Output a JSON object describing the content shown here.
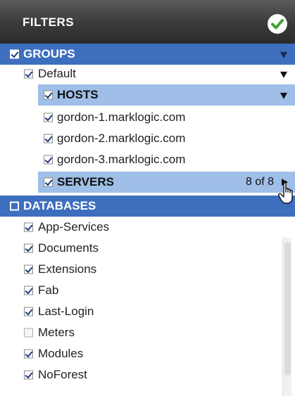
{
  "header": {
    "title": "FILTERS"
  },
  "groups": {
    "label": "GROUPS"
  },
  "default_group": {
    "label": "Default"
  },
  "hosts": {
    "label": "HOSTS",
    "items": [
      "gordon-1.marklogic.com",
      "gordon-2.marklogic.com",
      "gordon-3.marklogic.com"
    ]
  },
  "servers": {
    "label": "SERVERS",
    "count": "8 of 8"
  },
  "databases": {
    "label": "DATABASES",
    "items": [
      {
        "label": "App-Services",
        "checked": true
      },
      {
        "label": "Documents",
        "checked": true
      },
      {
        "label": "Extensions",
        "checked": true
      },
      {
        "label": "Fab",
        "checked": true
      },
      {
        "label": "Last-Login",
        "checked": true
      },
      {
        "label": "Meters",
        "checked": false
      },
      {
        "label": "Modules",
        "checked": true
      },
      {
        "label": "NoForest",
        "checked": true
      }
    ]
  },
  "colors": {
    "section_dark": "#3e6fbe",
    "section_light": "#9fbfe8",
    "header": "#3a3a3a",
    "ok_green": "#3aa534"
  }
}
